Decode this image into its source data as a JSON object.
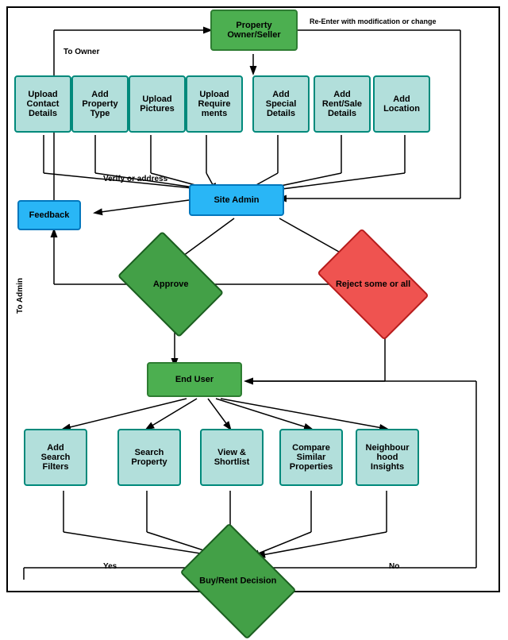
{
  "nodes": {
    "property_owner": {
      "label": "Property\nOwner/Seller"
    },
    "upload_contact": {
      "label": "Upload\nContact\nDetails"
    },
    "add_property": {
      "label": "Add\nProperty\nType"
    },
    "upload_pictures": {
      "label": "Upload\nPictures"
    },
    "upload_requirements": {
      "label": "Upload\nRequire\nments"
    },
    "add_special": {
      "label": "Add\nSpecial\nDetails"
    },
    "add_rent_sale": {
      "label": "Add\nRent/Sale\nDetails"
    },
    "add_location": {
      "label": "Add\nLocation"
    },
    "site_admin": {
      "label": "Site Admin"
    },
    "feedback": {
      "label": "Feedback"
    },
    "approve": {
      "label": "Approve"
    },
    "reject": {
      "label": "Reject\nsome or all"
    },
    "end_user": {
      "label": "End User"
    },
    "add_search_filters": {
      "label": "Add\nSearch\nFilters"
    },
    "search_property": {
      "label": "Search\nProperty"
    },
    "view_shortlist": {
      "label": "View &\nShortlist"
    },
    "compare_similar": {
      "label": "Compare\nSimilar\nProperties"
    },
    "neighbourhood": {
      "label": "Neighbour\nhood\nInsights"
    },
    "buy_rent": {
      "label": "Buy/Rent\nDecision"
    }
  },
  "labels": {
    "to_owner": "To Owner",
    "re_enter": "Re-Enter with modification or change",
    "verify_or_address": "Verify or address",
    "to_admin": "To Admin",
    "yes": "Yes",
    "no": "No"
  }
}
